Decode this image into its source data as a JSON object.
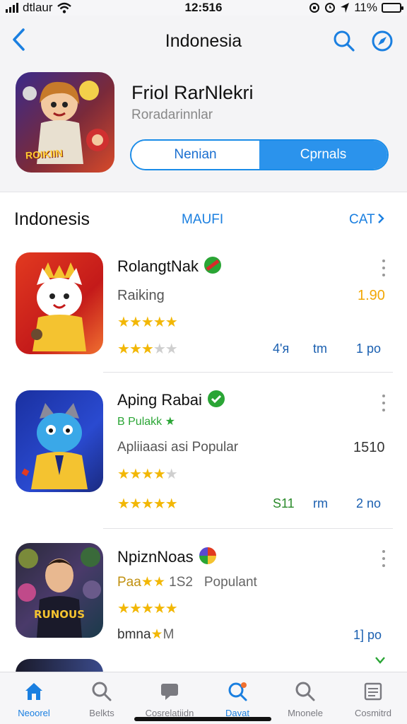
{
  "status": {
    "carrier": "dtlaur",
    "time": "12:516",
    "battery": "11%",
    "battery_level": 0.55
  },
  "nav": {
    "title": "Indonesia",
    "back_icon": "chevron-left-icon",
    "search_icon": "search-icon",
    "compass_icon": "compass-icon"
  },
  "featured": {
    "name": "Friol RarNlekri",
    "subtitle": "Roradarinnlar",
    "logo_text": "ROIKIIN"
  },
  "segments": {
    "left": "Nenian",
    "right": "Cprnals",
    "selected": "right"
  },
  "list": {
    "title": "Indonesis",
    "more_link": "MAUFI",
    "cat_link": "CAT"
  },
  "apps": [
    {
      "name": "RolangtNak",
      "line2": "Raiking",
      "line2_value": "1.90",
      "rating_a": 5,
      "rating_b": 3,
      "stat1": "4'я",
      "stat2": "tm",
      "stat3": "1 po"
    },
    {
      "name": "Aping Rabai",
      "tag": "B Pulakk",
      "line2": "Apliiaasi asi Popular",
      "line2_value": "1510",
      "rating_a": 3.5,
      "rating_b": 5,
      "stat1": "S11",
      "stat2": "rm",
      "stat3": "2 no"
    },
    {
      "name": "NpiznNoas",
      "tag": "Paa",
      "tag2": "1S2",
      "tag3": "Populant",
      "rating_a": 5,
      "line3": "bmna",
      "line3_suffix": "M",
      "stat3": "1] po"
    }
  ],
  "tabs": [
    {
      "label": "Neoorel",
      "icon": "home-icon"
    },
    {
      "label": "Belkts",
      "icon": "search-icon"
    },
    {
      "label": "Cosrelatiidn",
      "icon": "chat-icon"
    },
    {
      "label": "Davat",
      "icon": "search-badge-icon"
    },
    {
      "label": "Mnonele",
      "icon": "magnifier-icon"
    },
    {
      "label": "Cosmitrd",
      "icon": "document-icon"
    }
  ],
  "colors": {
    "accent": "#1a7fe0",
    "star": "#f2b705",
    "green": "#2aa535"
  }
}
